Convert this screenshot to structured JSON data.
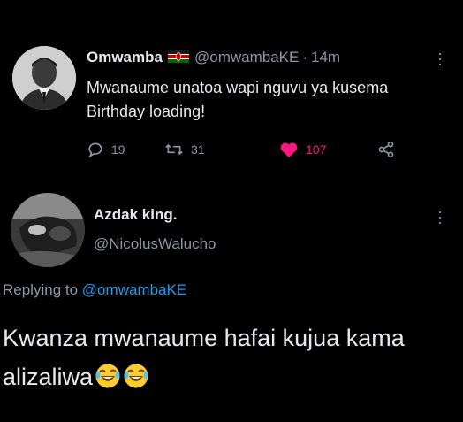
{
  "tweet": {
    "author_name": "Omwamba",
    "author_handle": "@omwambaKE",
    "separator": "·",
    "time": "14m",
    "text": "Mwanaume unatoa wapi nguvu ya kusema Birthday loading!",
    "replies_count": "19",
    "retweets_count": "31",
    "likes_count": "107",
    "liked": true,
    "like_color": "#f91880"
  },
  "reply": {
    "author_name": "Azdak king.",
    "author_handle": "@NicolusWalucho",
    "replying_prefix": "Replying to",
    "replying_to": "@omwambaKE",
    "text": "Kwanza mwanaume hafai kujua kama alizaliwa",
    "emojis": [
      "joy-emoji",
      "joy-emoji"
    ]
  },
  "icons": {
    "reply": "comment-icon",
    "retweet": "retweet-icon",
    "like": "heart-icon",
    "share": "share-icon",
    "more": "more-vertical-icon",
    "flag": "kenya-flag-icon"
  },
  "colors": {
    "background": "#000000",
    "text_primary": "#e7e9ea",
    "text_secondary": "#8b98a5",
    "link": "#1d9bf0"
  }
}
